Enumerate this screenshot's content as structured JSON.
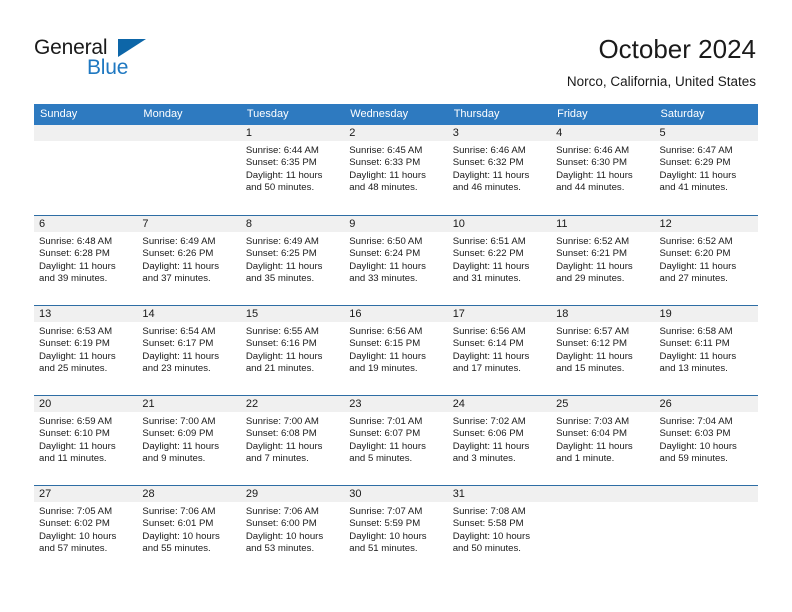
{
  "brand": {
    "name_part1": "General",
    "name_part2": "Blue",
    "accent_color": "#1F78C1",
    "triangle_color": "#0D66A8",
    "triangle_icon": "triangle-icon"
  },
  "header": {
    "title": "October 2024",
    "location": "Norco, California, United States"
  },
  "calendar": {
    "header_bg": "#2E7AC0",
    "row_divider_color": "#2E6DA4",
    "date_strip_bg": "#F0F0F0",
    "weekdays": [
      "Sunday",
      "Monday",
      "Tuesday",
      "Wednesday",
      "Thursday",
      "Friday",
      "Saturday"
    ],
    "weeks": [
      [
        {
          "date": "",
          "empty": true
        },
        {
          "date": "",
          "empty": true
        },
        {
          "date": "1",
          "sunrise": "Sunrise: 6:44 AM",
          "sunset": "Sunset: 6:35 PM",
          "daylight": "Daylight: 11 hours and 50 minutes."
        },
        {
          "date": "2",
          "sunrise": "Sunrise: 6:45 AM",
          "sunset": "Sunset: 6:33 PM",
          "daylight": "Daylight: 11 hours and 48 minutes."
        },
        {
          "date": "3",
          "sunrise": "Sunrise: 6:46 AM",
          "sunset": "Sunset: 6:32 PM",
          "daylight": "Daylight: 11 hours and 46 minutes."
        },
        {
          "date": "4",
          "sunrise": "Sunrise: 6:46 AM",
          "sunset": "Sunset: 6:30 PM",
          "daylight": "Daylight: 11 hours and 44 minutes."
        },
        {
          "date": "5",
          "sunrise": "Sunrise: 6:47 AM",
          "sunset": "Sunset: 6:29 PM",
          "daylight": "Daylight: 11 hours and 41 minutes."
        }
      ],
      [
        {
          "date": "6",
          "sunrise": "Sunrise: 6:48 AM",
          "sunset": "Sunset: 6:28 PM",
          "daylight": "Daylight: 11 hours and 39 minutes."
        },
        {
          "date": "7",
          "sunrise": "Sunrise: 6:49 AM",
          "sunset": "Sunset: 6:26 PM",
          "daylight": "Daylight: 11 hours and 37 minutes."
        },
        {
          "date": "8",
          "sunrise": "Sunrise: 6:49 AM",
          "sunset": "Sunset: 6:25 PM",
          "daylight": "Daylight: 11 hours and 35 minutes."
        },
        {
          "date": "9",
          "sunrise": "Sunrise: 6:50 AM",
          "sunset": "Sunset: 6:24 PM",
          "daylight": "Daylight: 11 hours and 33 minutes."
        },
        {
          "date": "10",
          "sunrise": "Sunrise: 6:51 AM",
          "sunset": "Sunset: 6:22 PM",
          "daylight": "Daylight: 11 hours and 31 minutes."
        },
        {
          "date": "11",
          "sunrise": "Sunrise: 6:52 AM",
          "sunset": "Sunset: 6:21 PM",
          "daylight": "Daylight: 11 hours and 29 minutes."
        },
        {
          "date": "12",
          "sunrise": "Sunrise: 6:52 AM",
          "sunset": "Sunset: 6:20 PM",
          "daylight": "Daylight: 11 hours and 27 minutes."
        }
      ],
      [
        {
          "date": "13",
          "sunrise": "Sunrise: 6:53 AM",
          "sunset": "Sunset: 6:19 PM",
          "daylight": "Daylight: 11 hours and 25 minutes."
        },
        {
          "date": "14",
          "sunrise": "Sunrise: 6:54 AM",
          "sunset": "Sunset: 6:17 PM",
          "daylight": "Daylight: 11 hours and 23 minutes."
        },
        {
          "date": "15",
          "sunrise": "Sunrise: 6:55 AM",
          "sunset": "Sunset: 6:16 PM",
          "daylight": "Daylight: 11 hours and 21 minutes."
        },
        {
          "date": "16",
          "sunrise": "Sunrise: 6:56 AM",
          "sunset": "Sunset: 6:15 PM",
          "daylight": "Daylight: 11 hours and 19 minutes."
        },
        {
          "date": "17",
          "sunrise": "Sunrise: 6:56 AM",
          "sunset": "Sunset: 6:14 PM",
          "daylight": "Daylight: 11 hours and 17 minutes."
        },
        {
          "date": "18",
          "sunrise": "Sunrise: 6:57 AM",
          "sunset": "Sunset: 6:12 PM",
          "daylight": "Daylight: 11 hours and 15 minutes."
        },
        {
          "date": "19",
          "sunrise": "Sunrise: 6:58 AM",
          "sunset": "Sunset: 6:11 PM",
          "daylight": "Daylight: 11 hours and 13 minutes."
        }
      ],
      [
        {
          "date": "20",
          "sunrise": "Sunrise: 6:59 AM",
          "sunset": "Sunset: 6:10 PM",
          "daylight": "Daylight: 11 hours and 11 minutes."
        },
        {
          "date": "21",
          "sunrise": "Sunrise: 7:00 AM",
          "sunset": "Sunset: 6:09 PM",
          "daylight": "Daylight: 11 hours and 9 minutes."
        },
        {
          "date": "22",
          "sunrise": "Sunrise: 7:00 AM",
          "sunset": "Sunset: 6:08 PM",
          "daylight": "Daylight: 11 hours and 7 minutes."
        },
        {
          "date": "23",
          "sunrise": "Sunrise: 7:01 AM",
          "sunset": "Sunset: 6:07 PM",
          "daylight": "Daylight: 11 hours and 5 minutes."
        },
        {
          "date": "24",
          "sunrise": "Sunrise: 7:02 AM",
          "sunset": "Sunset: 6:06 PM",
          "daylight": "Daylight: 11 hours and 3 minutes."
        },
        {
          "date": "25",
          "sunrise": "Sunrise: 7:03 AM",
          "sunset": "Sunset: 6:04 PM",
          "daylight": "Daylight: 11 hours and 1 minute."
        },
        {
          "date": "26",
          "sunrise": "Sunrise: 7:04 AM",
          "sunset": "Sunset: 6:03 PM",
          "daylight": "Daylight: 10 hours and 59 minutes."
        }
      ],
      [
        {
          "date": "27",
          "sunrise": "Sunrise: 7:05 AM",
          "sunset": "Sunset: 6:02 PM",
          "daylight": "Daylight: 10 hours and 57 minutes."
        },
        {
          "date": "28",
          "sunrise": "Sunrise: 7:06 AM",
          "sunset": "Sunset: 6:01 PM",
          "daylight": "Daylight: 10 hours and 55 minutes."
        },
        {
          "date": "29",
          "sunrise": "Sunrise: 7:06 AM",
          "sunset": "Sunset: 6:00 PM",
          "daylight": "Daylight: 10 hours and 53 minutes."
        },
        {
          "date": "30",
          "sunrise": "Sunrise: 7:07 AM",
          "sunset": "Sunset: 5:59 PM",
          "daylight": "Daylight: 10 hours and 51 minutes."
        },
        {
          "date": "31",
          "sunrise": "Sunrise: 7:08 AM",
          "sunset": "Sunset: 5:58 PM",
          "daylight": "Daylight: 10 hours and 50 minutes."
        },
        {
          "date": "",
          "empty": true
        },
        {
          "date": "",
          "empty": true
        }
      ]
    ]
  }
}
